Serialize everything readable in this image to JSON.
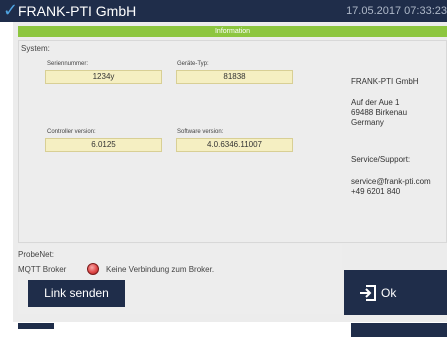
{
  "window": {
    "title": "FRANK-PTI GmbH",
    "datetime": "17.05.2017 07:33:23"
  },
  "infobar": {
    "label": "Information"
  },
  "system": {
    "section_label": "System:",
    "fields": {
      "serial": {
        "label": "Seriennummer:",
        "value": "1234y"
      },
      "device_type": {
        "label": "Geräte-Typ:",
        "value": "81838"
      },
      "controller_version": {
        "label": "Controller version:",
        "value": "6.0125"
      },
      "software_version": {
        "label": "Software version:",
        "value": "4.0.6346.11007"
      }
    },
    "company": {
      "name": "FRANK-PTI GmbH",
      "address_line1": "Auf der Aue 1",
      "address_line2": "69488 Birkenau",
      "country": "Germany",
      "support_label": "Service/Support:",
      "email": "service@frank-pti.com",
      "phone": "+49 6201 840"
    }
  },
  "probenet": {
    "section_label": "ProbeNet:",
    "mqtt_label": "MQTT Broker",
    "status_text": "Keine Verbindung zum Broker.",
    "status_color": "#e04848"
  },
  "buttons": {
    "send_link": "Link senden",
    "ok": "Ok"
  },
  "colors": {
    "navy": "#1f2d4a",
    "accent_green": "#8dc63f",
    "field_bg": "#f5efc2"
  }
}
